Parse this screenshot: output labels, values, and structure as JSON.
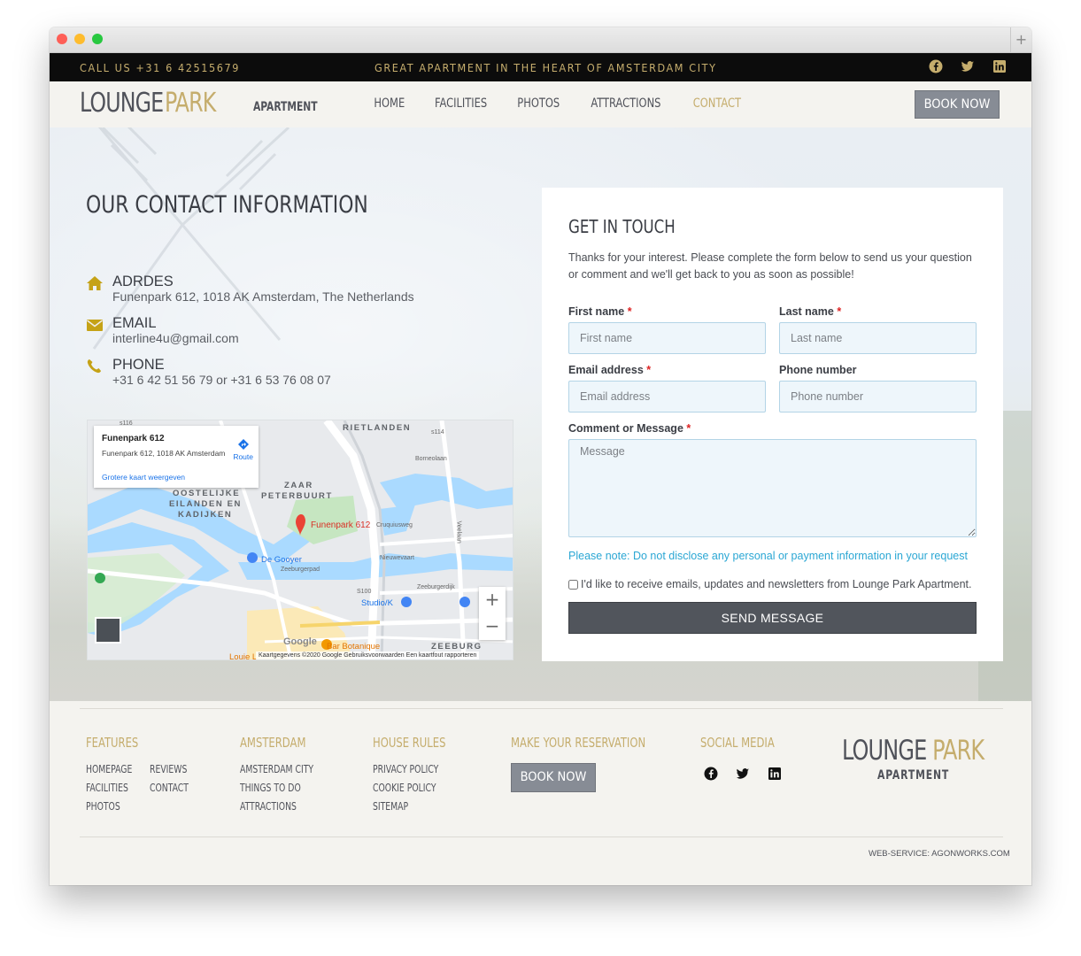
{
  "topbar": {
    "call": "CALL US +31 6 42515679",
    "tagline": "GREAT APARTMENT IN THE HEART OF AMSTERDAM CITY"
  },
  "logo": {
    "word1": "LOUNGE",
    "word2": "PARK",
    "word3": "APARTMENT"
  },
  "nav": {
    "items": [
      "HOME",
      "FACILITIES",
      "PHOTOS",
      "ATTRACTIONS",
      "CONTACT"
    ],
    "active": "CONTACT",
    "book_now": "BOOK NOW"
  },
  "contact": {
    "title": "OUR CONTACT INFORMATION",
    "address_label": "ADRDES",
    "address_value": "Funenpark 612, 1018 AK Amsterdam, The Netherlands",
    "email_label": "EMAIL",
    "email_value": "interline4u@gmail.com",
    "phone_label": "PHONE",
    "phone_value": "+31 6 42 51 56 79 or +31 6 53 76 08 07"
  },
  "map": {
    "place_name": "Funenpark 612",
    "place_address": "Funenpark 612, 1018 AK Amsterdam",
    "route": "Route",
    "larger_map": "Grotere kaart weergeven",
    "pin_label": "Funenpark 612",
    "attribution": "Kaartgegevens ©2020 Google   Gebruiksvoorwaarden   Een kaartfout rapporteren",
    "google": "Google",
    "zoom_in": "+",
    "zoom_out": "−",
    "labels": {
      "rietlanden": "RIETLANDEN",
      "zaar": "ZAAR",
      "peterbuurt": "PETERBUURT",
      "oostelijke": "OOSTELIJKE",
      "eilanden": "EILANDEN EN",
      "kadijken": "KADIJKEN",
      "zeeburg": "ZEEBURG",
      "de_gooyer": "De Gooyer",
      "studio": "Studio/K",
      "bar": "Bar Botanique",
      "louie": "Louie L",
      "cruquiusweg": "Cruquiusweg",
      "zeeburgerdijk": "Zeeburgerdijk",
      "veelaan": "Veelaan",
      "neuwevaart": "Nieuwevaart",
      "zeeburgerpad": "Zeeburgerpad",
      "borneolaan": "Borneolaan",
      "s116": "s116",
      "s114": "s114",
      "s100": "S100"
    }
  },
  "form": {
    "title": "GET IN TOUCH",
    "intro": "Thanks for your interest. Please complete the form below to send us your question or comment and we'll get back to you as soon as possible!",
    "first_name_label": "First name",
    "first_name_placeholder": "First name",
    "last_name_label": "Last name",
    "last_name_placeholder": "Last name",
    "email_label": "Email address",
    "email_placeholder": "Email address",
    "phone_label": "Phone number",
    "phone_placeholder": "Phone number",
    "message_label": "Comment or Message",
    "message_placeholder": "Message",
    "required_mark": "*",
    "note": "Please note: Do not disclose any personal or payment information in your request",
    "optin": "I'd like to receive emails, updates and newsletters from Lounge Park Apartment.",
    "send": "SEND MESSAGE"
  },
  "footer": {
    "features": {
      "heading": "FEATURES",
      "links": [
        "HOMEPAGE",
        "REVIEWS",
        "FACILITIES",
        "CONTACT",
        "PHOTOS"
      ]
    },
    "amsterdam": {
      "heading": "AMSTERDAM",
      "links": [
        "AMSTERDAM CITY",
        "THINGS TO DO",
        "ATTRACTIONS"
      ]
    },
    "house_rules": {
      "heading": "HOUSE RULES",
      "links": [
        "PRIVACY POLICY",
        "COOKIE POLICY",
        "SITEMAP"
      ]
    },
    "reservation": {
      "heading": "MAKE YOUR RESERVATION",
      "button": "BOOK NOW"
    },
    "social": {
      "heading": "SOCIAL MEDIA"
    },
    "logo": {
      "word1": "LOUNGE",
      "word2": "PARK",
      "word3": "APARTMENT"
    },
    "credit": "WEB-SERVICE: AGONWORKS.COM"
  },
  "colors": {
    "gold": "#c5ad6d",
    "dark": "#50525a",
    "button_grey": "#878c95",
    "note_blue": "#2ba7d4"
  },
  "icons": [
    "home-icon",
    "envelope-icon",
    "phone-icon",
    "facebook-icon",
    "twitter-icon",
    "linkedin-icon"
  ]
}
